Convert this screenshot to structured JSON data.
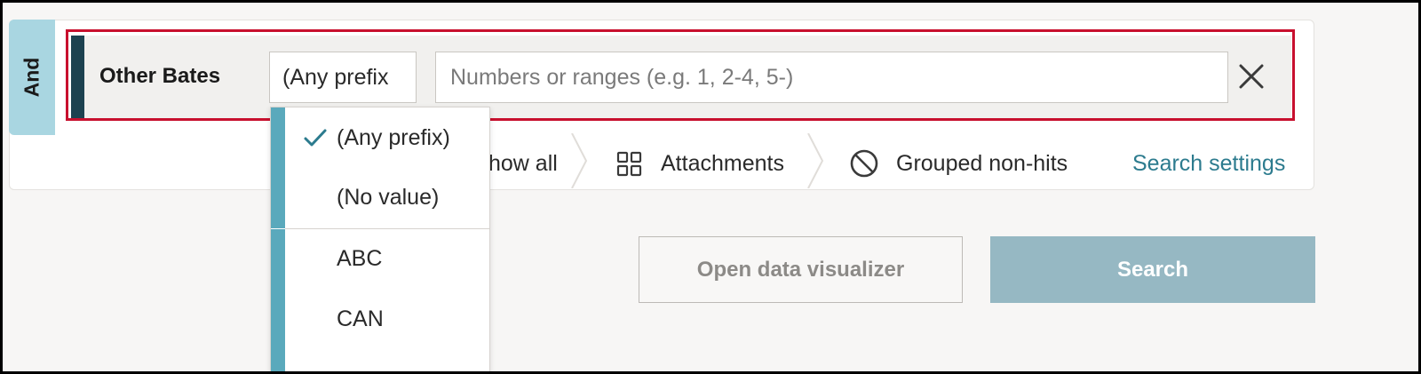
{
  "condition": {
    "connector": "And",
    "field_label": "Other Bates"
  },
  "prefix_select": {
    "selected": "(Any prefix"
  },
  "range_input": {
    "value": "",
    "placeholder": "Numbers or ranges (e.g. 1, 2-4, 5-)"
  },
  "options_bar": {
    "show_all_label": "how all",
    "attachments_label": "Attachments",
    "grouped_nonhits_label": "Grouped non-hits",
    "search_settings_link": "Search settings"
  },
  "actions": {
    "visualizer_label": "Open data visualizer",
    "search_label": "Search"
  },
  "dropdown": {
    "options": [
      {
        "label": "(Any prefix)",
        "checked": true
      },
      {
        "label": "(No value)",
        "checked": false
      },
      {
        "label": "ABC",
        "checked": false
      },
      {
        "label": "CAN",
        "checked": false
      }
    ]
  },
  "colors": {
    "accent": "#5aa9bc",
    "row_accent": "#1d4250",
    "highlight_outline": "#c8102e",
    "link": "#2c7b8e",
    "search_button": "#96b8c3"
  },
  "icons": [
    "close-icon",
    "chevron-separator-icon",
    "attachments-grid-icon",
    "grouped-nonhits-ban-icon",
    "check-icon"
  ]
}
